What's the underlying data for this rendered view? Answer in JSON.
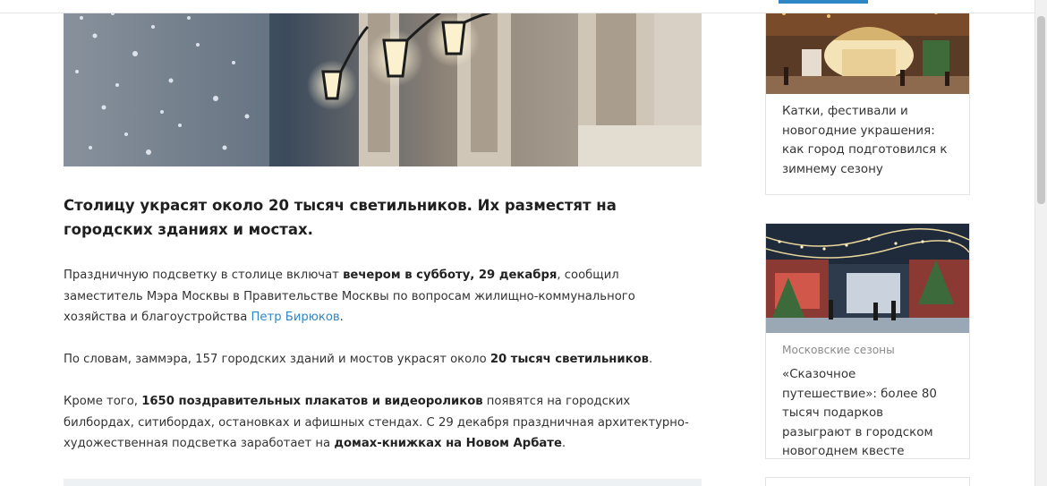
{
  "article": {
    "hero_alt": "Праздничные фонари на фасаде здания",
    "lead": "Столицу украсят около 20 тысяч светильников. Их разместят на городских зданиях и мостах.",
    "p1": {
      "t1": "Праздничную подсветку в столице включат ",
      "b1": "вечером в субботу, 29 декабря",
      "t2": ", сообщил заместитель Мэра Москвы в Правительстве Москвы по вопросам жилищно-коммунального хозяйства и благоустройства ",
      "link": "Петр Бирюков",
      "t3": "."
    },
    "p2": {
      "t1": "По словам, заммэра, 157 городских зданий и мостов украсят около ",
      "b1": "20 тысяч светильников",
      "t2": "."
    },
    "p3": {
      "t1": "Кроме того, ",
      "b1": "1650 поздравительных плакатов и видеороликов",
      "t2": " появятся на городских билбордах, ситибордах, остановках и афишных стендах. С 29 декабря праздничная архитектурно-художественная подсветка заработает на ",
      "b2": "домах-книжках на Новом Арбате",
      "t3": "."
    }
  },
  "sidebar": {
    "cards": [
      {
        "category": "",
        "title": "Катки, фестивали и новогодние украшения: как город подготовился к зимнему сезону"
      },
      {
        "category": "Московские сезоны",
        "title": "«Сказочное путешествие»: более 80 тысяч подарков разыграют в городском новогоднем квесте"
      }
    ]
  },
  "colors": {
    "link": "#2f86c5",
    "accent": "#2f86c5",
    "border": "#e3e3e3"
  }
}
